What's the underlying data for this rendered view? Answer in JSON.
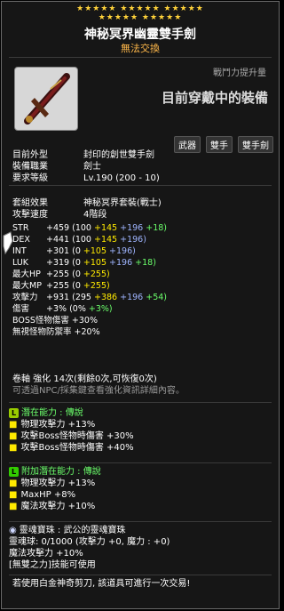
{
  "stars": {
    "row1": "★★★★★ ★★★★★ ★★★★★",
    "row2": "★★★★★ ★★★★★"
  },
  "item": {
    "name": "神秘冥界幽靈雙手劍",
    "trade": "無法交換"
  },
  "header": {
    "power_label": "戰鬥力提升量",
    "equipped_label": "目前穿戴中的裝備",
    "chips": [
      "武器",
      "雙手",
      "雙手劍"
    ]
  },
  "info": [
    {
      "k": "目前外型",
      "v": "封印的創世雙手劍"
    },
    {
      "k": "裝備職業",
      "v": "劍士"
    },
    {
      "k": "要求等級",
      "v": "Lv.190 (200 - 10)"
    }
  ],
  "set": {
    "k": "套組效果",
    "v": "神秘冥界套裝(戰士)"
  },
  "speed": {
    "k": "攻擊速度",
    "v": "4階段"
  },
  "stats": [
    {
      "k": "STR",
      "total": "+459",
      "base": "(100",
      "p1": "+145",
      "p2": "+196",
      "p3": "+18)"
    },
    {
      "k": "DEX",
      "total": "+441",
      "base": "(100",
      "p1": "+145",
      "p2": "+196)",
      "p3": ""
    },
    {
      "k": "INT",
      "total": "+301",
      "base": "(0",
      "p1": "+105",
      "p2": "+196)",
      "p3": ""
    },
    {
      "k": "LUK",
      "total": "+319",
      "base": "(0",
      "p1": "+105",
      "p2": "+196",
      "p3": "+18)"
    },
    {
      "k": "最大HP",
      "total": "+255",
      "base": "(0",
      "p1": "+255)",
      "p2": "",
      "p3": ""
    },
    {
      "k": "最大MP",
      "total": "+255",
      "base": "(0",
      "p1": "+255)",
      "p2": "",
      "p3": ""
    },
    {
      "k": "攻擊力",
      "total": "+931",
      "base": "(295",
      "p1": "+386",
      "p2": "+196",
      "p3": "+54)"
    },
    {
      "k": "傷害",
      "total": "+3%",
      "base": "(0%",
      "p1": "+3%)",
      "p2": "",
      "p3": ""
    }
  ],
  "boss": "BOSS怪物傷害 +30%",
  "ignore": "無視怪物防禦率 +20%",
  "scroll": {
    "line1": "卷軸 強化 14次(剩餘0次,可恢復0次)",
    "line2": "可透過NPC/採集鍵查看強化資訊詳細內容。"
  },
  "potential": {
    "title": "潛在能力 : 傳說",
    "lines": [
      "物理攻擊力 +13%",
      "攻擊Boss怪物時傷害 +30%",
      "攻擊Boss怪物時傷害 +40%"
    ]
  },
  "additional": {
    "title": "附加潛在能力 : 傳說",
    "lines": [
      "物理攻擊力 +13%",
      "MaxHP +8%",
      "魔法攻擊力 +10%"
    ]
  },
  "soul": {
    "title": "靈魂寶珠 : 武公的靈魂寶珠",
    "line1": "靈魂球: 0/1000 (攻擊力 +0, 魔力 : +0)",
    "line2": "魔法攻擊力 +10%",
    "line3": "[無雙之力]技能可使用",
    "line4": "若使用白金神奇剪刀, 該道具可進行一次交易!"
  }
}
